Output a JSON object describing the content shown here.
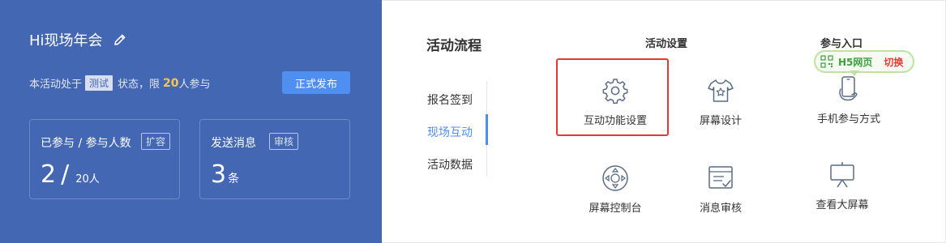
{
  "event": {
    "title": "Hi现场年会",
    "status_prefix": "本活动处于",
    "status_tag": "测试",
    "status_middle": "状态，限",
    "limit_count": "20",
    "status_suffix": "人参与",
    "publish_label": "正式发布"
  },
  "stats": [
    {
      "label": "已参与 / 参与人数",
      "tag": "扩容",
      "value": "2",
      "total": "20人"
    },
    {
      "label": "发送消息",
      "tag": "审核",
      "value": "3",
      "unit": "条"
    }
  ],
  "flow": {
    "title": "活动流程",
    "menu": [
      "报名签到",
      "现场互动",
      "活动数据"
    ],
    "active_index": 1
  },
  "columns": {
    "settings": "活动设置",
    "entry": "参与入口"
  },
  "tiles": {
    "interaction_settings": "互动功能设置",
    "screen_design": "屏幕设计",
    "phone_join": "手机参与方式",
    "screen_console": "屏幕控制台",
    "message_review": "消息审核",
    "view_big_screen": "查看大屏幕"
  },
  "h5": {
    "label": "H5网页",
    "switch_label": "切换"
  },
  "colors": {
    "panel_blue": "#4367b2",
    "accent_blue": "#4f8ff2",
    "highlight_red": "#e53935",
    "count_yellow": "#f7c64a",
    "h5_green": "#3aa33d"
  },
  "icons": {
    "edit": "pencil-icon",
    "interaction_settings": "gear-icon",
    "screen_design": "tshirt-icon",
    "phone_join": "phone-hand-icon",
    "screen_console": "dpad-icon",
    "message_review": "review-list-icon",
    "view_big_screen": "projector-screen-icon",
    "h5": "qrcode-icon"
  }
}
